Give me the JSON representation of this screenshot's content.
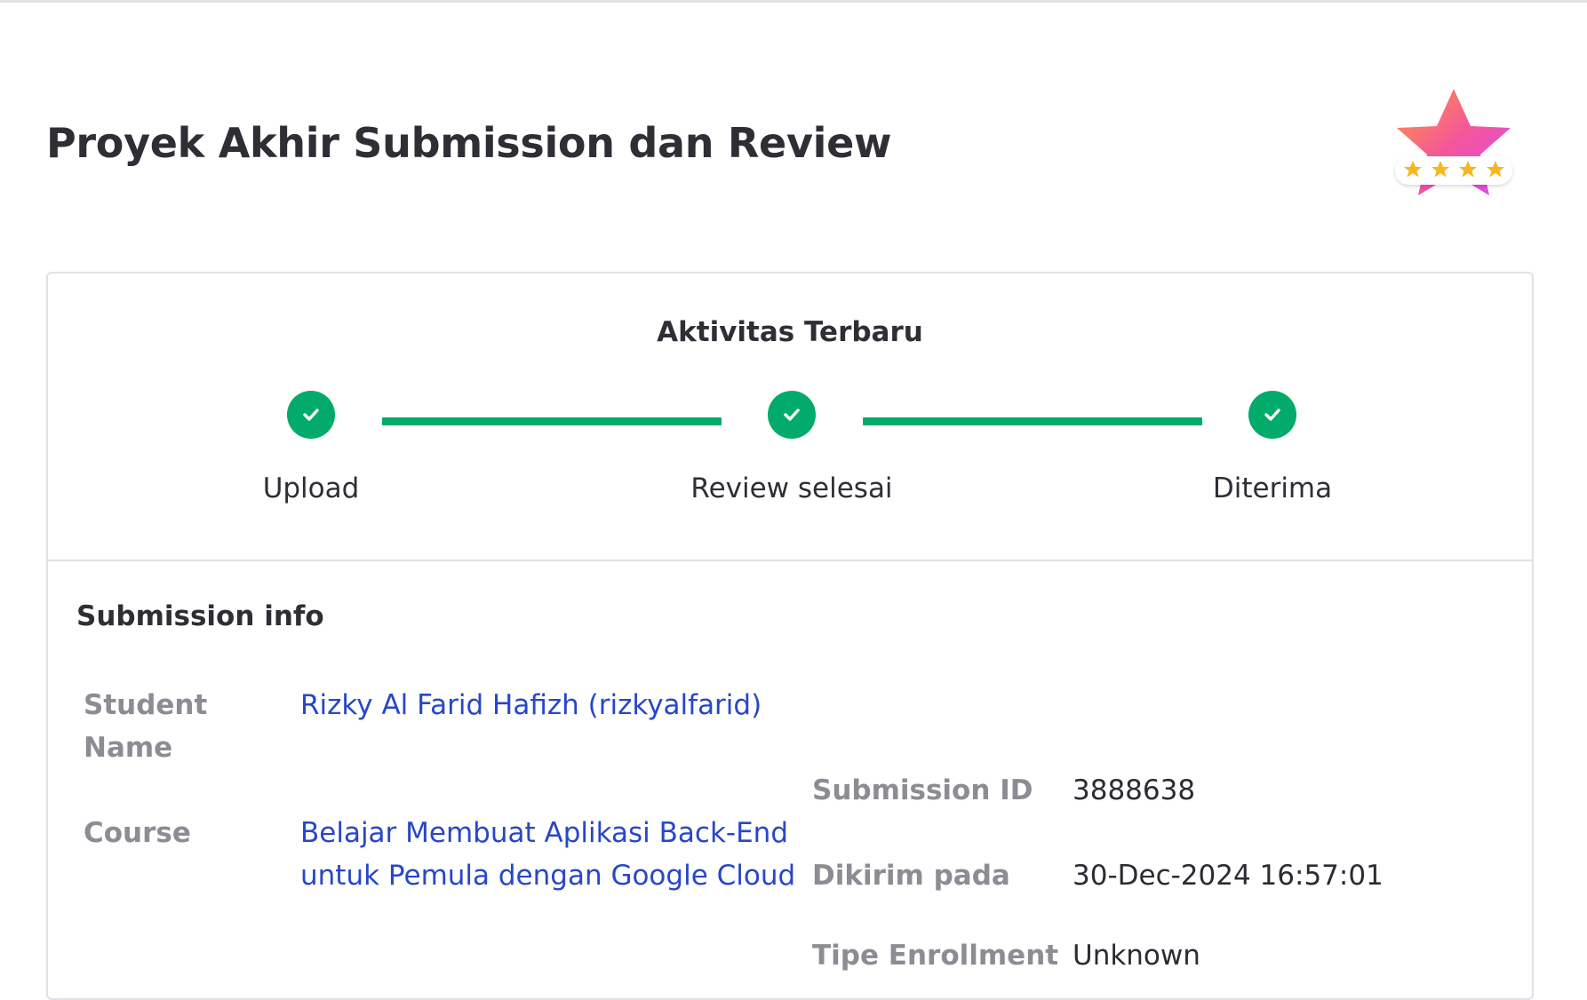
{
  "page": {
    "title": "Proyek Akhir Submission dan Review"
  },
  "badge": {
    "icon": "rating-star-badge-icon",
    "rating": 4,
    "rating_max": 4,
    "colors": {
      "star_gradient": [
        "#ff8a3d",
        "#e94cf0"
      ],
      "mini_star": "#f8b51d"
    }
  },
  "activity": {
    "title": "Aktivitas Terbaru",
    "steps": [
      {
        "label": "Upload",
        "status": "done",
        "icon": "check-icon"
      },
      {
        "label": "Review selesai",
        "status": "done",
        "icon": "check-icon"
      },
      {
        "label": "Diterima",
        "status": "done",
        "icon": "check-icon"
      }
    ],
    "progress": 1.0,
    "colors": {
      "done": "#03ab6a"
    }
  },
  "submission_info": {
    "title": "Submission info",
    "student_name": {
      "label": "Student Name",
      "value": "Rizky Al Farid Hafizh (rizkyalfarid)"
    },
    "course": {
      "label": "Course",
      "value": "Belajar Membuat Aplikasi Back-End untuk Pemula dengan Google Cloud"
    },
    "submission_id": {
      "label": "Submission ID",
      "value": "3888638"
    },
    "submitted_at": {
      "label": "Dikirim pada",
      "value": "30-Dec-2024 16:57:01"
    },
    "enrollment_type": {
      "label": "Tipe Enrollment",
      "value": "Unknown"
    }
  },
  "colors": {
    "link": "#2747c9",
    "label": "#8c8c94",
    "border": "#e1e1e5"
  }
}
